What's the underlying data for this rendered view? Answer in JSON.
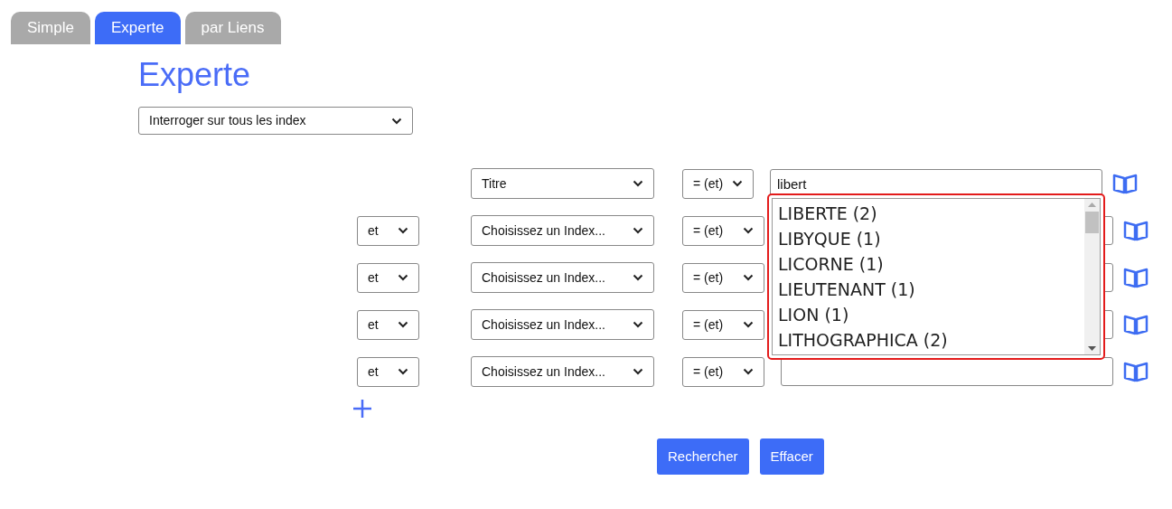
{
  "tabs": [
    {
      "label": "Simple",
      "selected": false
    },
    {
      "label": "Experte",
      "selected": true
    },
    {
      "label": "par Liens",
      "selected": false
    }
  ],
  "heading": "Experte",
  "scope_select": {
    "value": "Interroger sur tous les index"
  },
  "criteria": [
    {
      "index": "Titre",
      "operator": "= (et)",
      "value": "libert"
    },
    {
      "conjunction": "et",
      "index": "Choisissez un Index...",
      "operator": "= (et)"
    },
    {
      "conjunction": "et",
      "index": "Choisissez un Index...",
      "operator": "= (et)"
    },
    {
      "conjunction": "et",
      "index": "Choisissez un Index...",
      "operator": "= (et)"
    },
    {
      "conjunction": "et",
      "index": "Choisissez un Index...",
      "operator": "= (et)"
    }
  ],
  "suggestions": [
    "LIBERTE (2)",
    "LIBYQUE (1)",
    "LICORNE (1)",
    "LIEUTENANT (1)",
    "LION (1)",
    "LITHOGRAPHICA (2)"
  ],
  "buttons": [
    "Rechercher",
    "Effacer"
  ]
}
